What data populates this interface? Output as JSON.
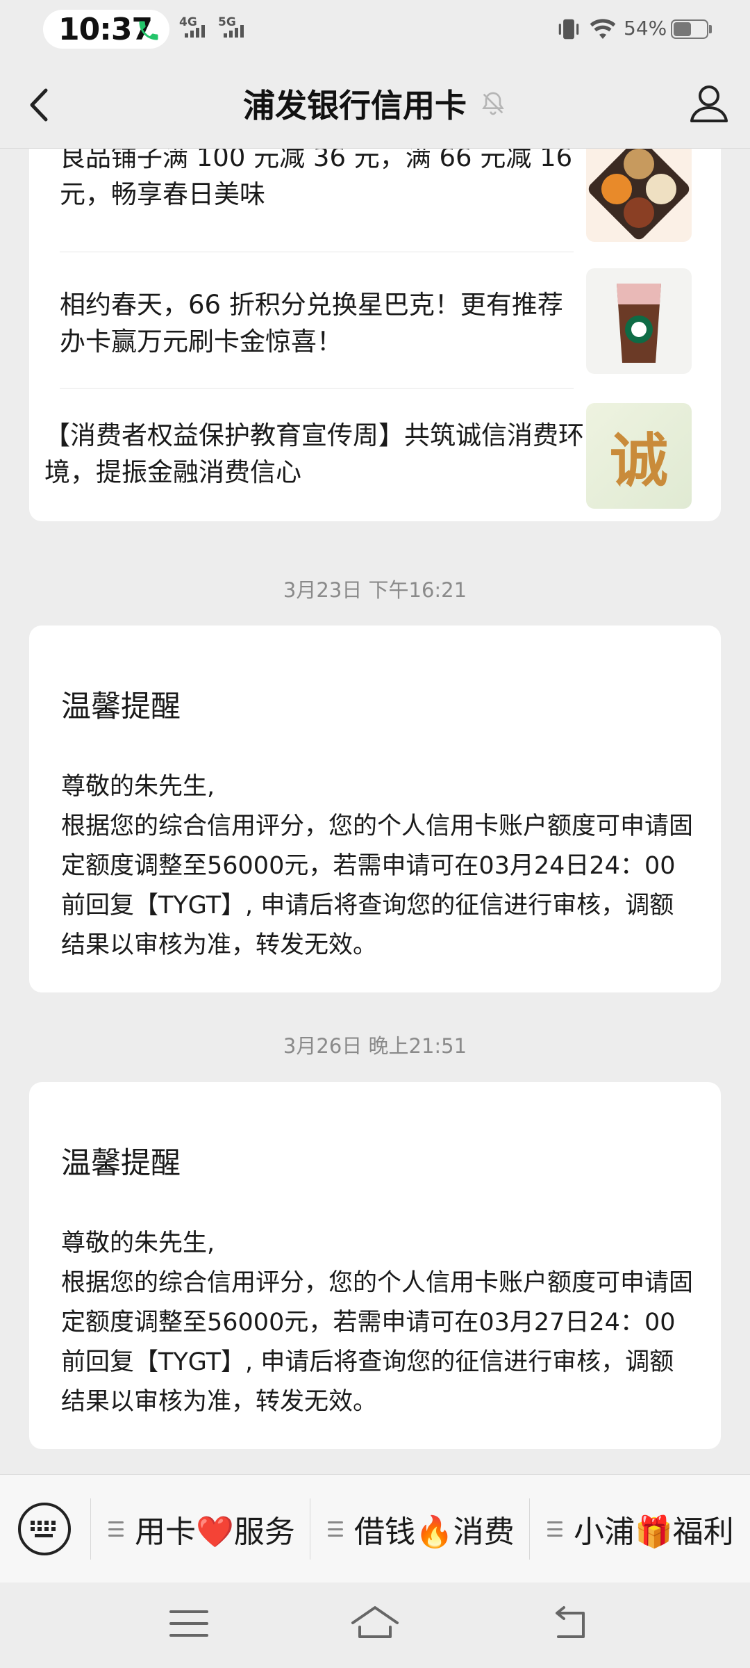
{
  "status_bar": {
    "time": "10:37",
    "network_1": "4G",
    "network_2": "5G",
    "battery": "54%"
  },
  "header": {
    "title": "浦发银行信用卡"
  },
  "news": [
    {
      "text": "良品铺子满 100 元减 36 元，满 66 元减 16 元，畅享春日美味",
      "image": "snack-platter-thumbnail"
    },
    {
      "text": "相约春天，66 折积分兑换星巴克！更有推荐办卡赢万元刷卡金惊喜！",
      "image": "starbucks-drink-thumbnail"
    },
    {
      "text": "【消费者权益保护教育宣传周】共筑诚信消费环境，提振金融消费信心",
      "image": "calligraphy-character-thumbnail",
      "glyph": "诚"
    }
  ],
  "messages": [
    {
      "timestamp": "3月23日 下午16:21",
      "title": "温馨提醒",
      "greeting": "尊敬的朱先生,",
      "body": "根据您的综合信用评分，您的个人信用卡账户额度可申请固定额度调整至56000元，若需申请可在03月24日24：00前回复【TYGT】, 申请后将查询您的征信进行审核，调额结果以审核为准，转发无效。"
    },
    {
      "timestamp": "3月26日 晚上21:51",
      "title": "温馨提醒",
      "greeting": "尊敬的朱先生,",
      "body": "根据您的综合信用评分，您的个人信用卡账户额度可申请固定额度调整至56000元，若需申请可在03月27日24：00前回复【TYGT】, 申请后将查询您的征信进行审核，调额结果以审核为准，转发无效。"
    }
  ],
  "menu": {
    "items": [
      {
        "label": "用卡❤️服务"
      },
      {
        "label": "借钱🔥消费"
      },
      {
        "label": "小浦🎁福利"
      }
    ]
  },
  "colors": {
    "background": "#ededed",
    "card": "#ffffff",
    "timestamp": "#8a8a8a"
  }
}
